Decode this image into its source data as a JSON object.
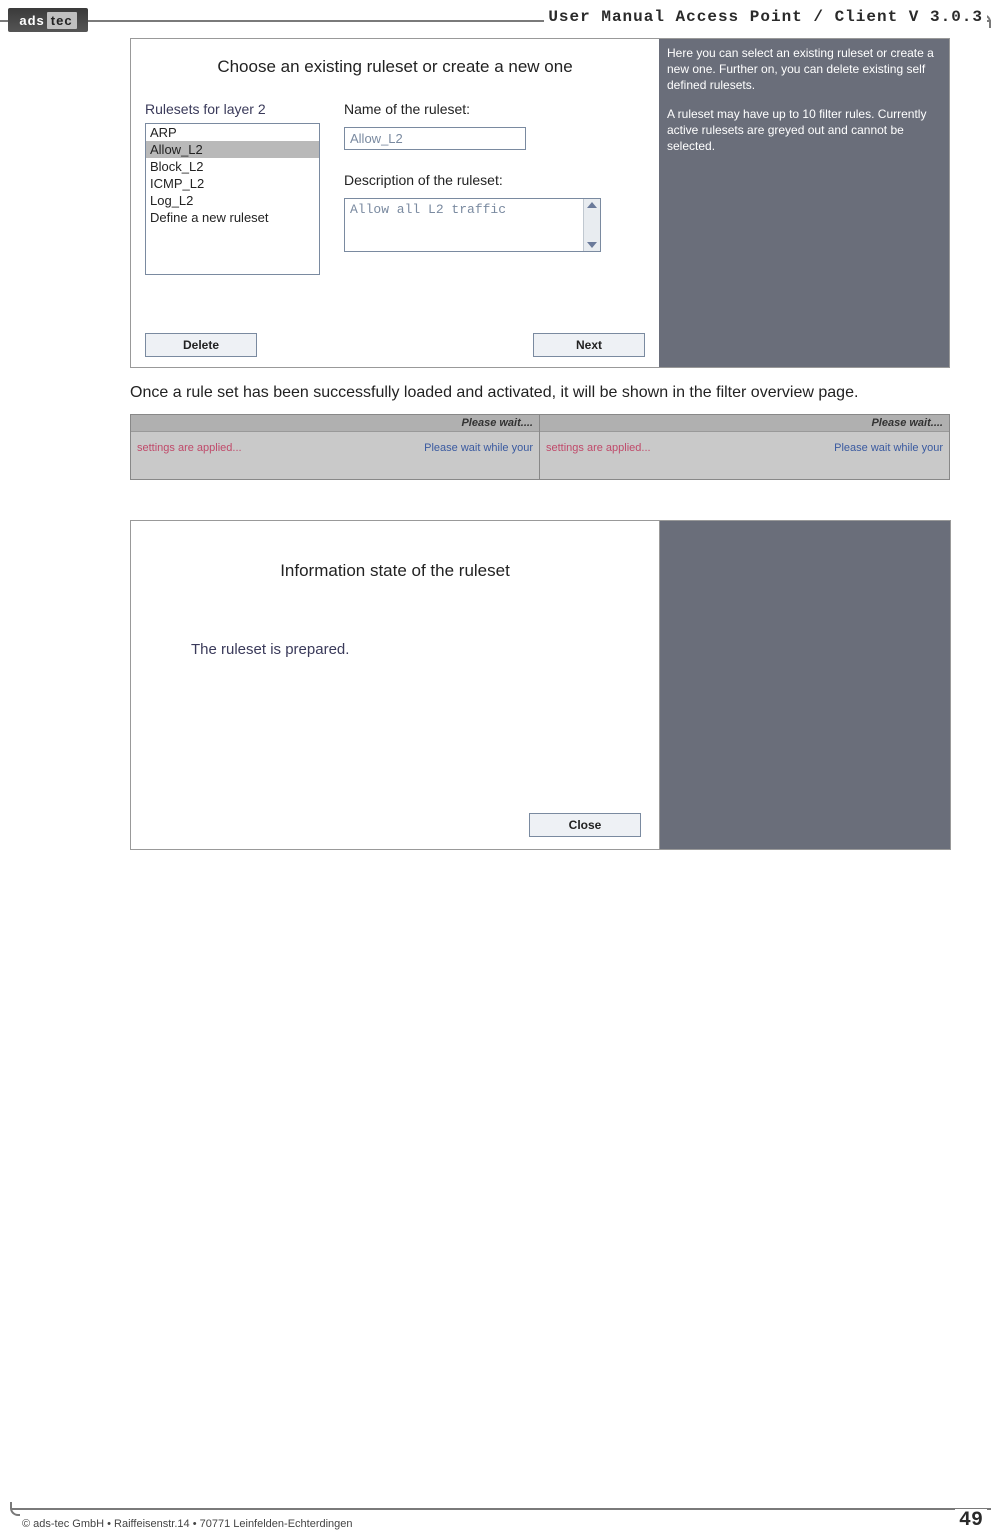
{
  "header": {
    "logo_text_1": "ads",
    "logo_text_2": "tec",
    "title": "User Manual Access  Point / Client V 3.0.3"
  },
  "screenshot1": {
    "title": "Choose an existing ruleset or create a new one",
    "list_label": "Rulesets for layer 2",
    "list_items": [
      "ARP",
      "Allow_L2",
      "Block_L2",
      "ICMP_L2",
      "Log_L2",
      "Define a new ruleset"
    ],
    "list_selected_index": 1,
    "name_label": "Name of the ruleset:",
    "name_value": "Allow_L2",
    "desc_label": "Description of the ruleset:",
    "desc_value": "Allow all L2 traffic",
    "btn_delete": "Delete",
    "btn_next": "Next",
    "side_p1": "Here you can select an existing ruleset or create a new one. Further on, you can delete existing self defined rulesets.",
    "side_p2": "A ruleset may have up to 10 filter rules. Currently active rulesets are greyed out and cannot be selected."
  },
  "body_paragraph": "Once a rule set has been successfully loaded and activated, it will be shown in the filter overview page.",
  "screenshot2": {
    "title": "Please wait....",
    "left_a": "settings are applied...",
    "left_b": "Please wait while your",
    "right_a": "settings are applied...",
    "right_b": "Please wait while your"
  },
  "screenshot3": {
    "title": "Information state of the ruleset",
    "message": "The ruleset is prepared.",
    "btn_close": "Close"
  },
  "footer": {
    "copyright": "© ads-tec GmbH • Raiffeisenstr.14 • 70771 Leinfelden-Echterdingen",
    "page": "49"
  }
}
